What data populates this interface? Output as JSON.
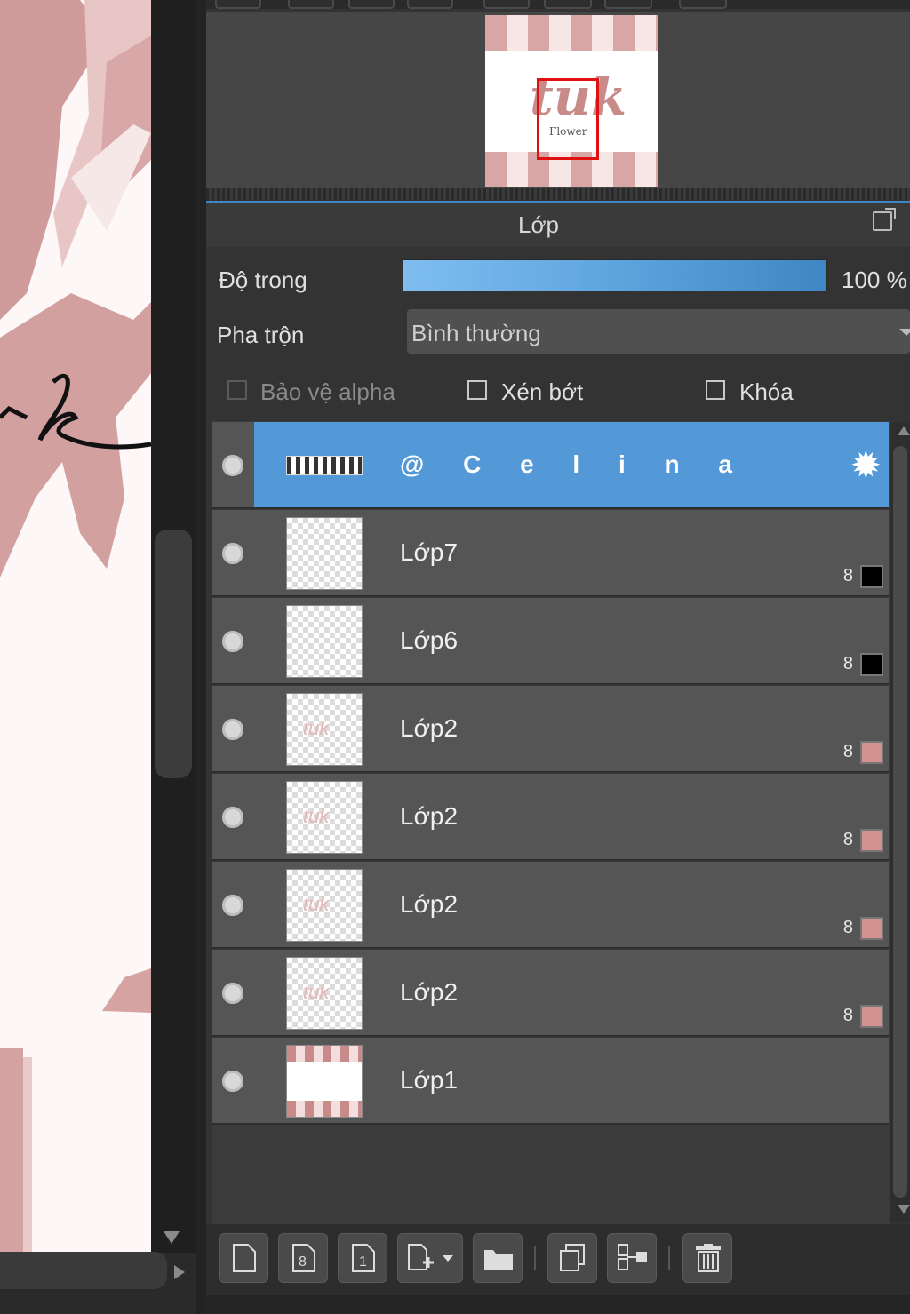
{
  "layers_panel": {
    "title": "Lớp",
    "opacity_label": "Độ trong",
    "opacity_value": "100 %",
    "opacity_fraction": 1.0,
    "blend_label": "Pha trộn",
    "blend_value": "Bình thường",
    "protect_alpha_label": "Bảo vệ alpha",
    "clipping_label": "Xén bớt",
    "lock_label": "Khóa"
  },
  "layers": [
    {
      "name": "@ C e l i n a",
      "selected": true,
      "kind": "group"
    },
    {
      "name": "Lớp7",
      "bit": "8",
      "color": "#000000",
      "kind": "normal"
    },
    {
      "name": "Lớp6",
      "bit": "8",
      "color": "#000000",
      "kind": "normal"
    },
    {
      "name": "Lớp2",
      "bit": "8",
      "color": "#d4918f",
      "kind": "normal"
    },
    {
      "name": "Lớp2",
      "bit": "8",
      "color": "#d4918f",
      "kind": "normal"
    },
    {
      "name": "Lớp2",
      "bit": "8",
      "color": "#d4918f",
      "kind": "normal"
    },
    {
      "name": "Lớp2",
      "bit": "8",
      "color": "#d4918f",
      "kind": "normal"
    },
    {
      "name": "Lớp1",
      "kind": "base"
    }
  ],
  "colors": {
    "accent": "#5399d8",
    "canvas_pink": "#d4918f"
  },
  "navigator": {
    "thumbnail_text": "tuk",
    "thumbnail_subtext": "Flower"
  },
  "toolbar_icons": [
    "new-layer-icon",
    "new-8bit-layer-icon",
    "new-1bit-layer-icon",
    "add-layer-menu-icon",
    "new-folder-icon",
    "duplicate-layer-icon",
    "merge-down-icon",
    "delete-layer-icon"
  ]
}
